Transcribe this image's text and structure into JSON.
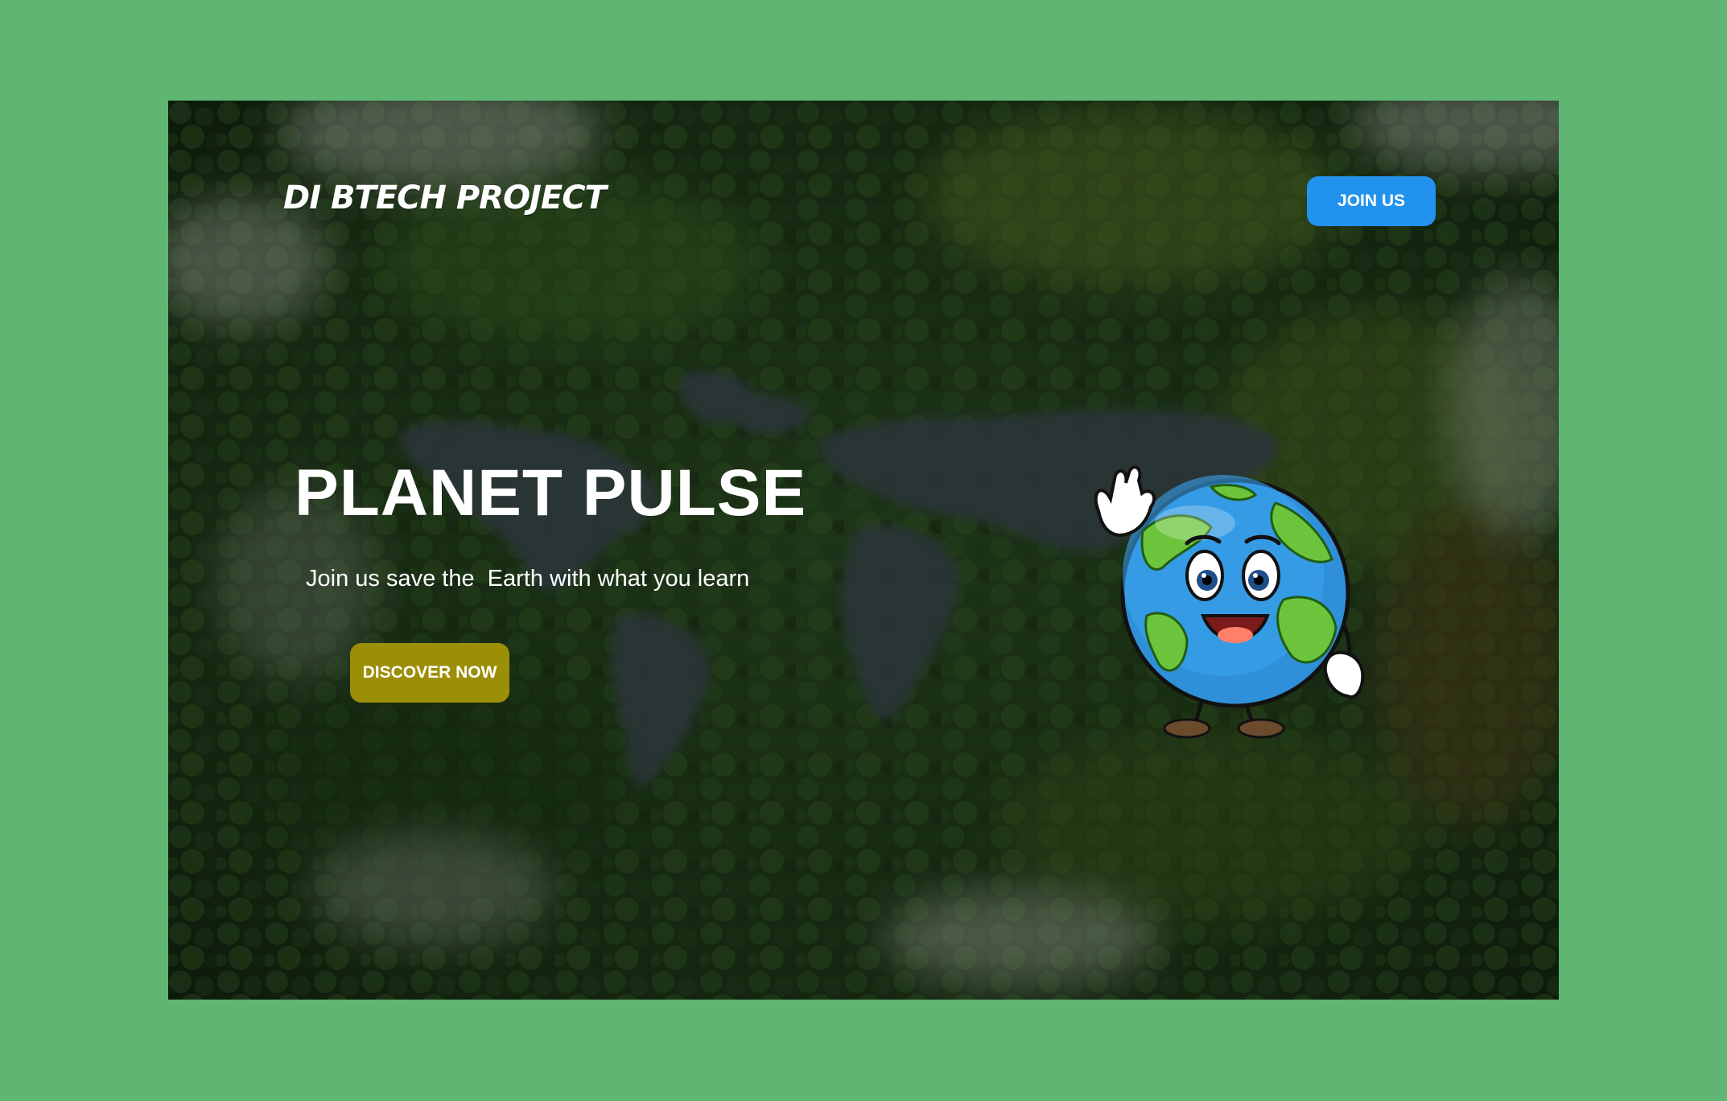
{
  "brand": {
    "name": "DI BTECH PROJECT"
  },
  "nav": {
    "join_label": "JOIN US"
  },
  "hero": {
    "title": "PLANET PULSE",
    "subtitle": "Join us save the  Earth with what you learn",
    "cta_label": "DISCOVER NOW"
  },
  "background": {
    "image": "forest-with-world-map-lake-aerial",
    "page_color": "#5fb672"
  },
  "mascot": {
    "icon": "waving-earth-mascot"
  },
  "colors": {
    "join_button": "#2193ee",
    "discover_button": "#9c8f05",
    "text": "#ffffff"
  }
}
